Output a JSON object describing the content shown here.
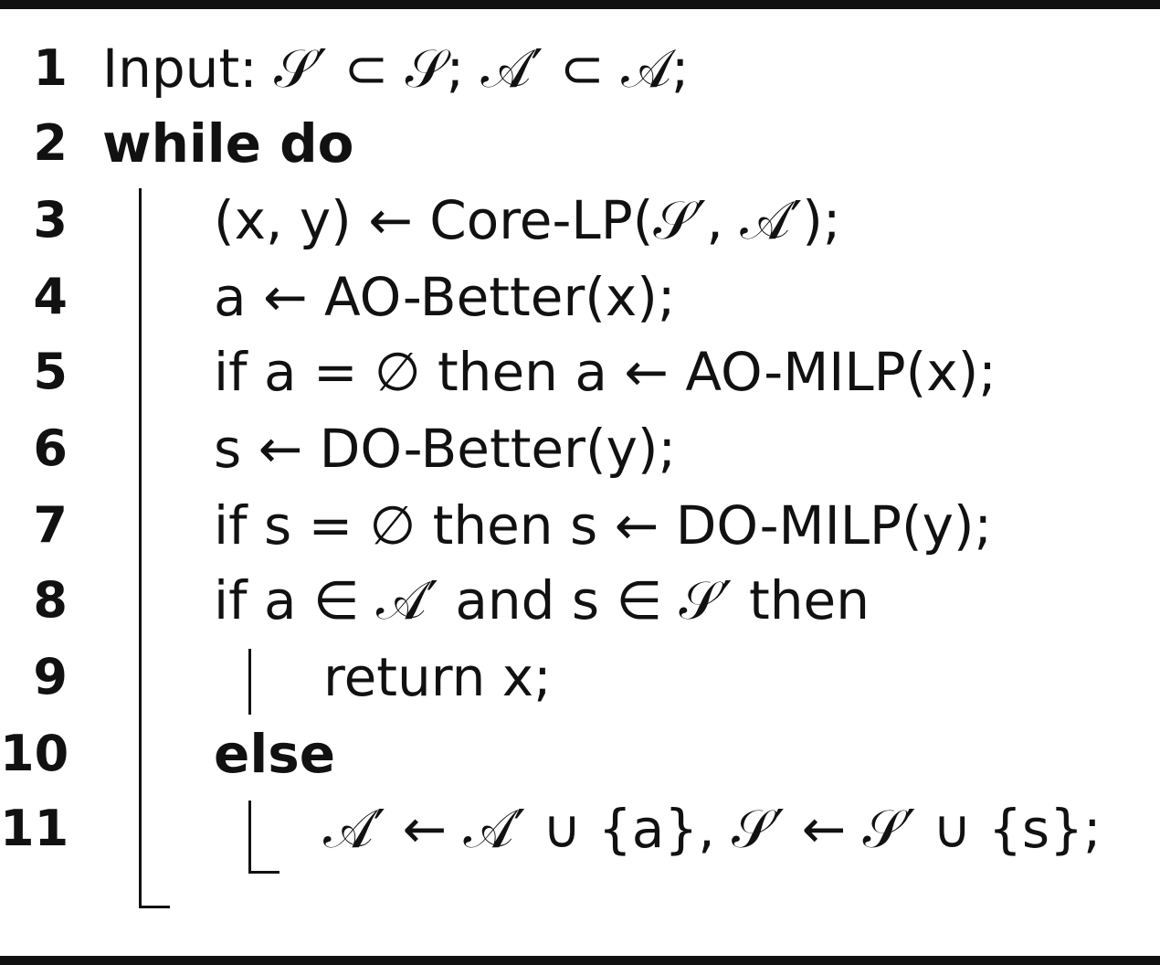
{
  "algorithm": {
    "lines": [
      {
        "n": "1",
        "text": "Input: 𝒮′ ⊂ 𝒮; 𝒜′ ⊂ 𝒜;"
      },
      {
        "n": "2",
        "text": "while do"
      },
      {
        "n": "3",
        "text": "(x, y) ← Core-LP(𝒮′, 𝒜′);"
      },
      {
        "n": "4",
        "text": "a ← AO-Better(x);"
      },
      {
        "n": "5",
        "text": "if a = ∅ then a ← AO-MILP(x);"
      },
      {
        "n": "6",
        "text": "s ← DO-Better(y);"
      },
      {
        "n": "7",
        "text": "if s = ∅ then s ← DO-MILP(y);"
      },
      {
        "n": "8",
        "text": "if a ∈ 𝒜′ and s ∈ 𝒮′ then"
      },
      {
        "n": "9",
        "text": "return x;"
      },
      {
        "n": "10",
        "text": "else"
      },
      {
        "n": "11",
        "text": "𝒜′ ← 𝒜′ ∪ {a}, 𝒮′ ← 𝒮′ ∪ {s};"
      }
    ]
  }
}
